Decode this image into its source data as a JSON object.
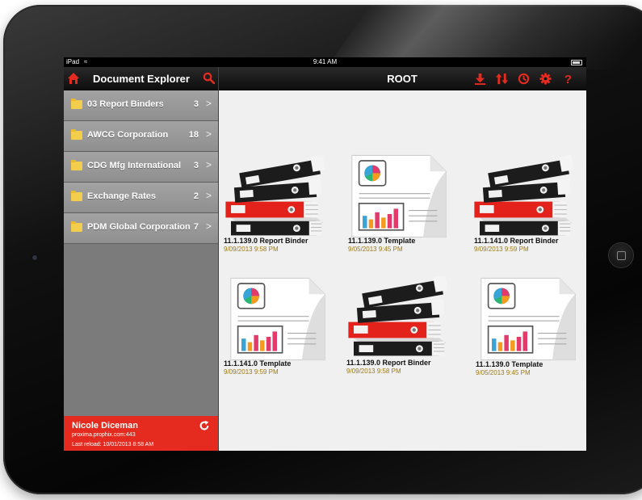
{
  "statusbar": {
    "carrier": "iPad",
    "time": "9:41 AM"
  },
  "sidebar": {
    "title": "Document Explorer",
    "items": [
      {
        "label": "03 Report Binders",
        "count": "3"
      },
      {
        "label": "AWCG Corporation",
        "count": "18"
      },
      {
        "label": "CDG Mfg International",
        "count": "3"
      },
      {
        "label": "Exchange Rates",
        "count": "2"
      },
      {
        "label": "PDM Global Corporation",
        "count": "7"
      }
    ],
    "footer": {
      "user": "Nicole Diceman",
      "server": "proxima.prophix.com:443",
      "last_reload": "Last reload: 10/01/2013 8:58 AM"
    }
  },
  "main": {
    "title": "ROOT",
    "toolbar_icons": [
      "download-icon",
      "sort-icon",
      "history-icon",
      "settings-icon",
      "help-icon"
    ],
    "documents": [
      {
        "type": "binder",
        "name": "11.1.139.0 Report Binder",
        "date": "9/09/2013 9:58 PM"
      },
      {
        "type": "template",
        "name": "11.1.139.0 Template",
        "date": "9/05/2013 9:45 PM"
      },
      {
        "type": "binder",
        "name": "11.1.141.0 Report Binder",
        "date": "9/09/2013 9:59 PM"
      },
      {
        "type": "template",
        "name": "11.1.141.0 Template",
        "date": "9/09/2013 9:59 PM"
      },
      {
        "type": "binder",
        "name": "11.1.139.0 Report Binder",
        "date": "9/09/2013 9:58 PM"
      },
      {
        "type": "template",
        "name": "11.1.139.0 Template",
        "date": "9/05/2013 9:45 PM"
      }
    ]
  },
  "colors": {
    "accent": "#e52b1f",
    "header": "#111111",
    "sidebar": "#8f8f8f",
    "date_text": "#9a7a1a"
  }
}
